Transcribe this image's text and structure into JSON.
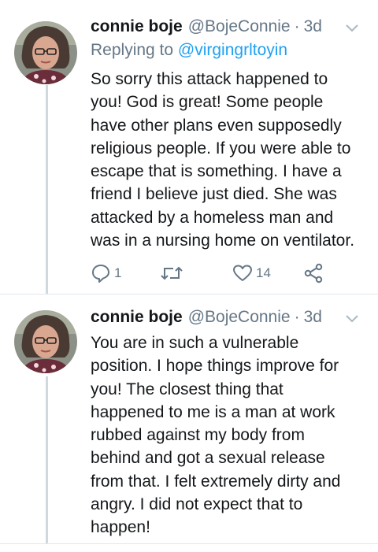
{
  "tweets": [
    {
      "author_name": "connie boje",
      "author_handle": "@BojeConnie",
      "separator": "·",
      "time": "3d",
      "reply_prefix": "Replying to",
      "reply_mention": "@virgingrltoyin",
      "text_lines": [
        "So sorry this attack happened to",
        "you! God is great! Some people",
        "have other plans even supposedly",
        "religious people. If you were able to",
        "escape that is something. I have a",
        "friend I believe just died. She was",
        "attacked by a homeless man and",
        "was in a nursing home on ventilator."
      ],
      "actions": {
        "reply_icon": "reply-icon",
        "reply_count": "1",
        "retweet_icon": "retweet-icon",
        "like_icon": "heart-icon",
        "like_count": "14",
        "share_icon": "share-icon"
      }
    },
    {
      "author_name": "connie boje",
      "author_handle": "@BojeConnie",
      "separator": "·",
      "time": "3d",
      "text_lines": [
        "You are in such a vulnerable",
        "position. I hope things improve for",
        "you! The closest thing that",
        "happened to me is a man at work",
        "rubbed against my body from",
        "behind and got a sexual release",
        "from that. I felt extremely dirty and",
        "angry. I did not expect that to",
        "happen!"
      ]
    }
  ],
  "colors": {
    "primary_text": "#14171a",
    "secondary_text": "#657786",
    "link": "#1da1f2",
    "thread_line": "#cfd9de",
    "divider": "#e1e8ed"
  }
}
